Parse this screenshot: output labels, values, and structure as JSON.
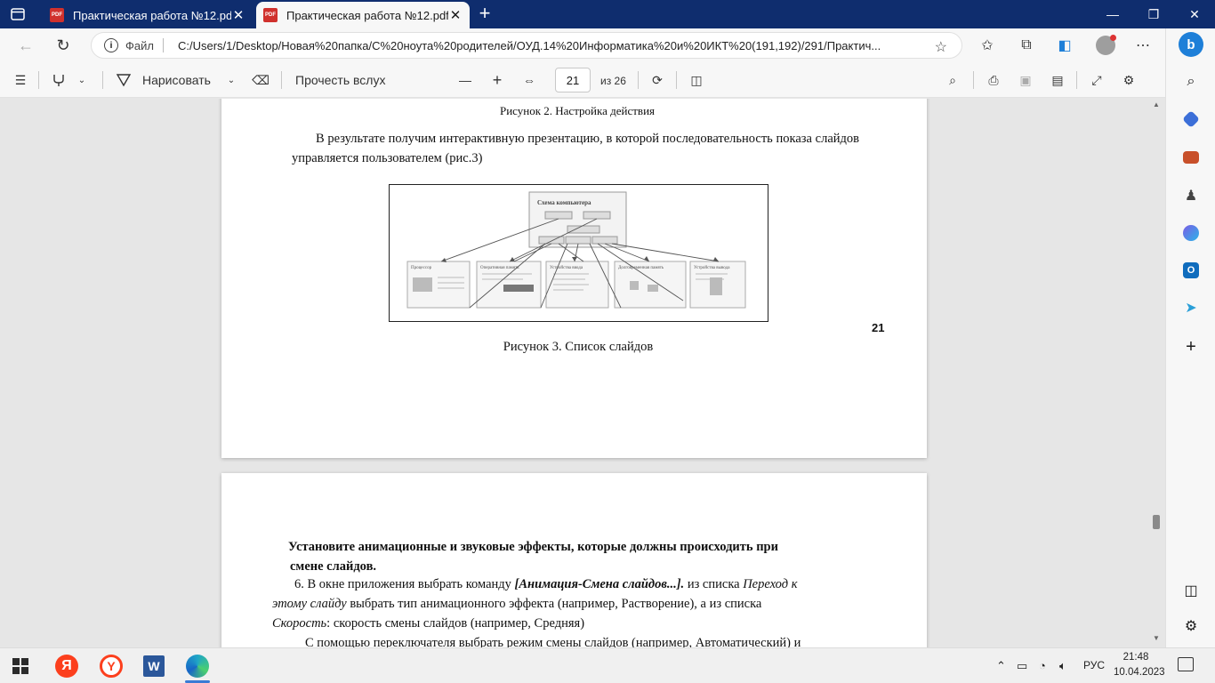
{
  "browser": {
    "tabs": [
      {
        "title": "Практическая работа №12.pdf",
        "icon": "pdf-icon",
        "active": false
      },
      {
        "title": "Практическая работа №12.pdf",
        "icon": "pdf-icon",
        "active": true
      }
    ],
    "pdf_icon_text": "PDF",
    "address": {
      "label": "Файл",
      "url": "C:/Users/1/Desktop/Новая%20папка/С%20ноута%20родителей/ОУД.14%20Информатика%20и%20ИКТ%20(191,192)/291/Практич..."
    },
    "sidebar_items": [
      "bing-icon",
      "search-icon",
      "shopping-tag-icon",
      "tools-icon",
      "games-icon",
      "microsoft365-icon",
      "outlook-icon",
      "telegram-icon",
      "add-icon",
      "split-screen-icon",
      "settings-icon"
    ]
  },
  "pdf_toolbar": {
    "draw_label": "Нарисовать",
    "read_aloud_label": "Прочесть вслух",
    "current_page": "21",
    "total_pages": "из 26"
  },
  "document": {
    "page1": {
      "caption_fig2": "Рисунок  2. Настройка действия",
      "paragraph": "В результате получим интерактивную презентацию, в которой последовательность показа слайдов управляется пользователем (рис.3)",
      "figure": {
        "main_slide_title": "Схема компьютера",
        "slide_titles": [
          "Процессор",
          "Оперативная память",
          "Устройства ввода",
          "Долговременная память",
          "Устройства вывода"
        ]
      },
      "caption_fig3": "Рисунок 3. Список слайдов",
      "page_number": "21"
    },
    "page2": {
      "heading_line1": "Установите анимационные и звуковые эффекты, которые должны происходить при",
      "heading_line2": "смене слайдов.",
      "step_prefix": "6. В окне приложения выбрать команду ",
      "step_command": "[Анимация-Смена слайдов...].",
      "step_mid1": " из списка ",
      "step_list1": "Переход к",
      "step_list1b": "этому слайду",
      "step_mid2": " выбрать тип анимационного эффекта (например, Растворение), а из списка",
      "step_list2": "Скорость",
      "step_end": ": скорость смены слайдов (например, Средняя)",
      "next_line": "С помощью переключателя выбрать режим смены слайдов (например, Автоматический) и"
    }
  },
  "taskbar": {
    "language": "РУС",
    "time": "21:48",
    "date": "10.04.2023",
    "yandex_letter": "Я",
    "yandex_browser_letter": "Y",
    "word_letter": "W"
  }
}
